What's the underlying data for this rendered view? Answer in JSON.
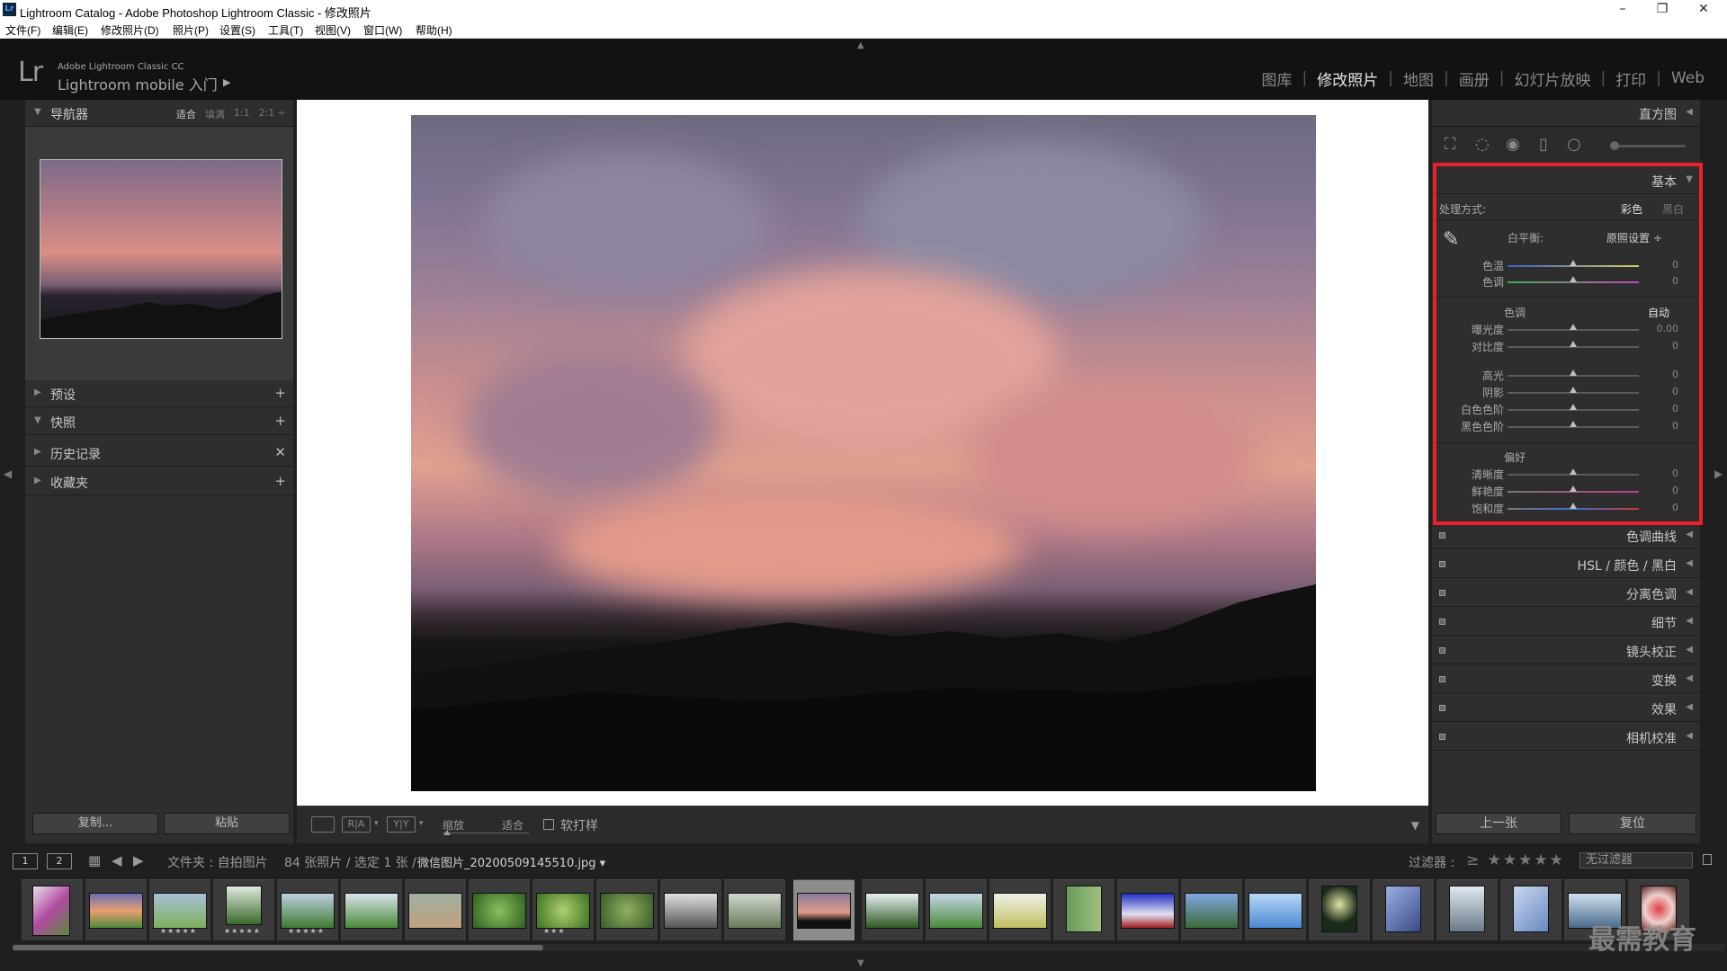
{
  "window": {
    "title": "Lightroom Catalog - Adobe Photoshop Lightroom Classic - 修改照片",
    "app_icon": "Lr",
    "controls": [
      "–",
      "❐",
      "✕"
    ]
  },
  "menu": [
    "文件(F)",
    "编辑(E)",
    "修改照片(D)",
    "照片(P)",
    "设置(S)",
    "工具(T)",
    "视图(V)",
    "窗口(W)",
    "帮助(H)"
  ],
  "identity": {
    "logo": "Lr",
    "small": "Adobe Lightroom Classic CC",
    "big": "Lightroom mobile 入门",
    "arrow": "▶"
  },
  "modules": [
    {
      "label": "图库",
      "active": false
    },
    {
      "label": "修改照片",
      "active": true
    },
    {
      "label": "地图",
      "active": false
    },
    {
      "label": "画册",
      "active": false
    },
    {
      "label": "幻灯片放映",
      "active": false
    },
    {
      "label": "打印",
      "active": false
    },
    {
      "label": "Web",
      "active": false
    }
  ],
  "left_panel": {
    "navigator": {
      "label": "导航器",
      "zoom_options": [
        "适合",
        "填满",
        "1:1",
        "2:1 ÷"
      ],
      "active_zoom": "适合"
    },
    "sections": [
      {
        "label": "预设",
        "action": "+"
      },
      {
        "label": "快照",
        "action": "+"
      },
      {
        "label": "历史记录",
        "action": "✕"
      },
      {
        "label": "收藏夹",
        "action": "+"
      }
    ],
    "copy_label": "复制...",
    "paste_label": "粘贴"
  },
  "toolbar": {
    "zoom_label": "缩放",
    "zoom_value": "适合",
    "view_buttons": [
      "",
      "R|A",
      "Y|Y"
    ],
    "softproof_label": "软打样",
    "dropdown": "▼"
  },
  "right_panel": {
    "histogram_label": "直方图",
    "basic": {
      "label": "基本",
      "treatment_label": "处理方式:",
      "treatment_color": "彩色",
      "treatment_bw": "黑白",
      "wb_label": "白平衡:",
      "wb_value": "原照设置 ÷",
      "tone_label": "色调",
      "auto_label": "自动",
      "presence_label": "偏好",
      "sliders": [
        {
          "label": "色温",
          "value": "0"
        },
        {
          "label": "色调",
          "value": "0"
        },
        {
          "label": "曝光度",
          "value": "0.00"
        },
        {
          "label": "对比度",
          "value": "0"
        },
        {
          "label": "高光",
          "value": "0"
        },
        {
          "label": "阴影",
          "value": "0"
        },
        {
          "label": "白色色阶",
          "value": "0"
        },
        {
          "label": "黑色色阶",
          "value": "0"
        },
        {
          "label": "清晰度",
          "value": "0"
        },
        {
          "label": "鲜艳度",
          "value": "0"
        },
        {
          "label": "饱和度",
          "value": "0"
        }
      ]
    },
    "collapsed_panels": [
      {
        "label": "色调曲线"
      },
      {
        "label": "HSL / 颜色 / 黑白"
      },
      {
        "label": "分离色调"
      },
      {
        "label": "细节"
      },
      {
        "label": "镜头校正"
      },
      {
        "label": "变换"
      },
      {
        "label": "效果"
      },
      {
        "label": "相机校准"
      }
    ],
    "prev_label": "上一张",
    "reset_label": "复位"
  },
  "filmstrip_bar": {
    "screen1": "1",
    "screen2": "2",
    "path": "文件夹 : 自拍图片",
    "count": "84 张照片 / 选定 1 张 /",
    "file": "微信图片_20200509145510.jpg ▾",
    "filter_label": "过滤器 :",
    "filter_stars": "≥ ★★★★★",
    "filter_value": "无过滤器"
  },
  "filmstrip": [
    {
      "stars": ""
    },
    {
      "stars": ""
    },
    {
      "stars": "★★★★★"
    },
    {
      "stars": "★★★★★"
    },
    {
      "stars": "★★★★★"
    },
    {
      "stars": ""
    },
    {
      "stars": ""
    },
    {
      "stars": ""
    },
    {
      "stars": "★★★"
    },
    {
      "stars": ""
    },
    {
      "stars": ""
    },
    {
      "stars": ""
    },
    {
      "stars": ""
    },
    {
      "stars": ""
    },
    {
      "stars": ""
    },
    {
      "stars": ""
    },
    {
      "stars": ""
    },
    {
      "stars": ""
    },
    {
      "stars": ""
    },
    {
      "stars": ""
    },
    {
      "stars": ""
    },
    {
      "stars": ""
    },
    {
      "stars": ""
    },
    {
      "stars": ""
    },
    {
      "stars": ""
    }
  ],
  "watermark": "最需教育"
}
